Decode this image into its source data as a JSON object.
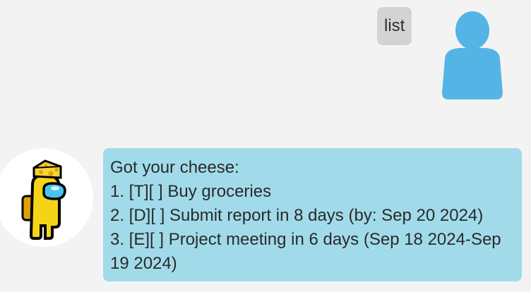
{
  "colors": {
    "background": "#f3f3f3",
    "user_bubble": "#d3d3d3",
    "bot_bubble": "#a1dbea",
    "user_avatar": "#55b4e6",
    "bot_body": "#f5d418"
  },
  "user_message": {
    "text": "list",
    "avatar_icon": "person-silhouette-icon"
  },
  "bot_message": {
    "avatar_icon": "crewmate-cheese-hat-icon",
    "lines": [
      "Got your cheese:",
      "1. [T][ ] Buy groceries",
      "2. [D][ ] Submit report in 8 days (by: Sep 20 2024)",
      "3. [E][ ] Project meeting in 6 days (Sep 18 2024-Sep 19 2024)"
    ]
  }
}
